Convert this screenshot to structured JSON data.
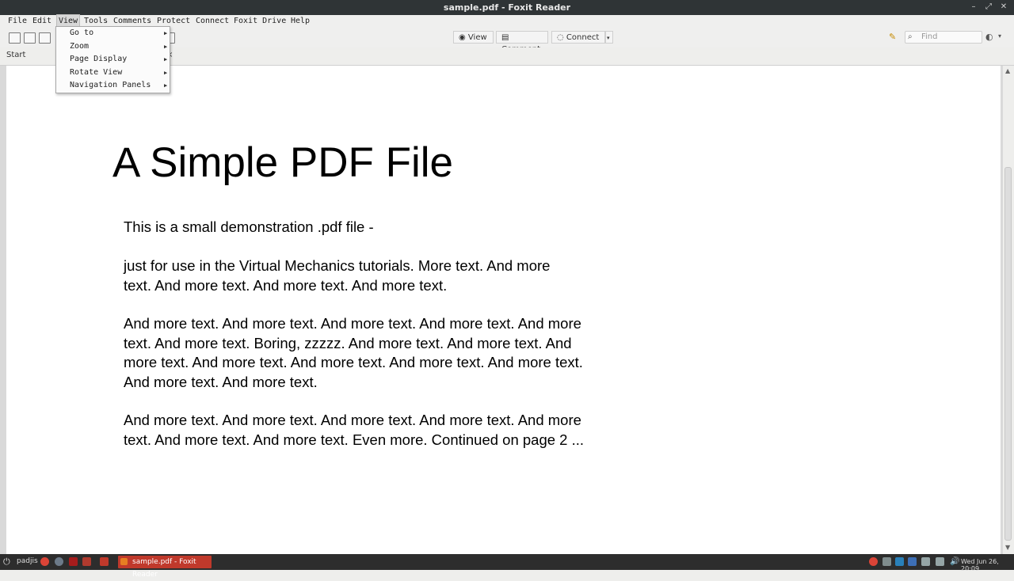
{
  "window": {
    "title": "sample.pdf - Foxit Reader"
  },
  "menubar": {
    "items": [
      "File",
      "Edit",
      "View",
      "Tools",
      "Comments",
      "Protect",
      "Connect",
      "Foxit Drive",
      "Help"
    ],
    "active": "View"
  },
  "view_menu": {
    "items": [
      "Go to",
      "Zoom",
      "Page Display",
      "Rotate View",
      "Navigation Panels"
    ]
  },
  "toolbar": {
    "tabs": [
      "View",
      "Comment",
      "Connect"
    ],
    "find_placeholder": "Find"
  },
  "tabs": {
    "start": "Start",
    "close": "×"
  },
  "document": {
    "title": "A Simple PDF File",
    "paragraphs": [
      "This is a small demonstration .pdf file -",
      "just for use in the Virtual Mechanics tutorials. More text. And more\ntext. And more text. And more text. And more text.",
      "And more text. And more text. And more text. And more text. And more\ntext. And more text. Boring, zzzzz. And more text. And more text. And\nmore text. And more text. And more text. And more text. And more text.\nAnd more text. And more text.",
      "And more text. And more text. And more text. And more text. And more\ntext. And more text. And more text. Even more. Continued on page 2 ..."
    ]
  },
  "taskbar": {
    "user": "padjis",
    "active_window": "sample.pdf - Foxit Reader",
    "clock": "Wed Jun 26, 20:09"
  }
}
